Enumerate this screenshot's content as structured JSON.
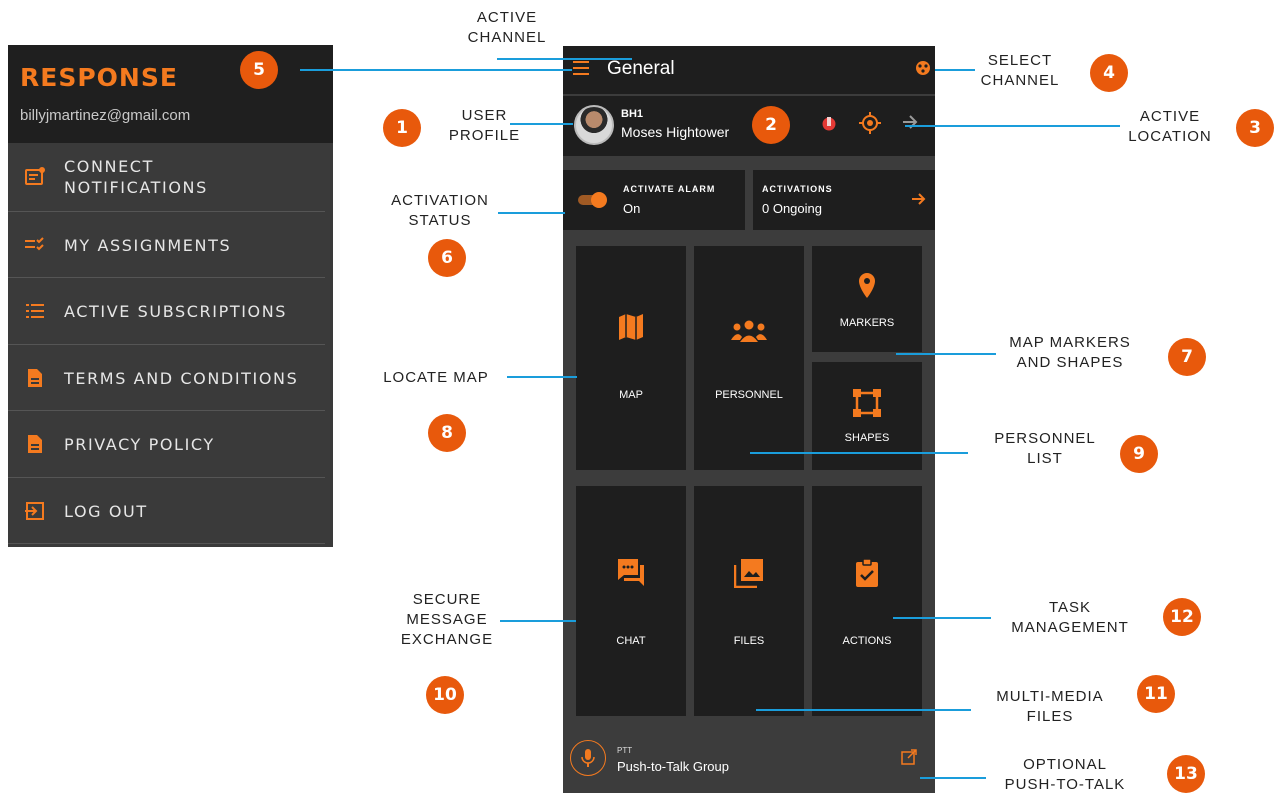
{
  "drawer": {
    "brand": "RESPONSE",
    "email": "billyjmartinez@gmail.com",
    "items": [
      {
        "label": "CONNECT\nNOTIFICATIONS",
        "icon": "notification-icon"
      },
      {
        "label": "MY ASSIGNMENTS",
        "icon": "checklist-icon"
      },
      {
        "label": "ACTIVE SUBSCRIPTIONS",
        "icon": "list-icon"
      },
      {
        "label": "TERMS AND CONDITIONS",
        "icon": "document-icon"
      },
      {
        "label": "PRIVACY POLICY",
        "icon": "document-icon"
      },
      {
        "label": "LOG OUT",
        "icon": "logout-icon"
      }
    ]
  },
  "phone": {
    "header": {
      "title": "General",
      "menu_icon": "menu-icon",
      "channel_icon": "channel-select-icon"
    },
    "profile": {
      "code": "BH1",
      "name": "Moses Hightower"
    },
    "alarm": {
      "label": "ACTIVATE ALARM",
      "value": "On"
    },
    "activations": {
      "label": "ACTIVATIONS",
      "value": "0 Ongoing"
    },
    "tiles": {
      "map": "MAP",
      "personnel": "PERSONNEL",
      "markers": "MARKERS",
      "shapes": "SHAPES",
      "chat": "CHAT",
      "files": "FILES",
      "actions": "ACTIONS"
    },
    "ptt": {
      "label": "PTT",
      "value": "Push-to-Talk Group"
    }
  },
  "callouts": {
    "c1": "USER\nPROFILE",
    "c2": "ACTIVE\nCHANNEL",
    "c3": "ACTIVE\nLOCATION",
    "c4": "SELECT\nCHANNEL",
    "c6": "ACTIVATION\nSTATUS",
    "c7": "MAP MARKERS\nAND SHAPES",
    "c8": "LOCATE MAP",
    "c9": "PERSONNEL\nLIST",
    "c10": "SECURE\nMESSAGE\nEXCHANGE",
    "c11": "MULTI-MEDIA\nFILES",
    "c12": "TASK\nMANAGEMENT",
    "c13": "OPTIONAL\nPUSH-TO-TALK"
  },
  "numbers": {
    "n1": "1",
    "n2": "2",
    "n3": "3",
    "n4": "4",
    "n5": "5",
    "n6": "6",
    "n7": "7",
    "n8": "8",
    "n9": "9",
    "n10": "10",
    "n11": "11",
    "n12": "12",
    "n13": "13"
  },
  "colors": {
    "accent": "#f47a1f",
    "callout_line": "#1a9ddb",
    "badge": "#e8590c",
    "dark": "#1e1e1e"
  }
}
